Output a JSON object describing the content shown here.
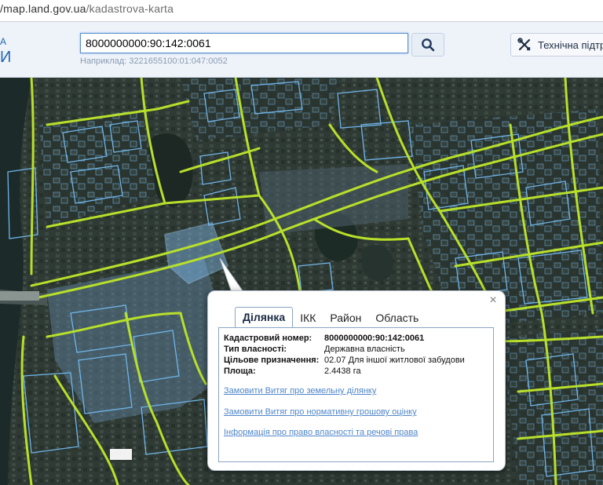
{
  "browser": {
    "url_host": "/map.land.gov.ua",
    "url_path": "/kadastrova-karta"
  },
  "header": {
    "logo_fragment_top": "А",
    "logo_fragment_bottom": "И",
    "search": {
      "value": "8000000000:90:142:0061",
      "example": "Наприклад: 3221655100:01:047:0052"
    },
    "support_label": "Технічна підтр"
  },
  "popup": {
    "tabs": [
      "Ділянка",
      "ІКК",
      "Район",
      "Область"
    ],
    "active_tab": "Ділянка",
    "fields": [
      {
        "key": "Кадастровий номер:",
        "value": "8000000000:90:142:0061"
      },
      {
        "key": "Тип власності:",
        "value": "Державна власність"
      },
      {
        "key": "Цільове призначення:",
        "value": "02.07 Для іншої житлової забудови"
      },
      {
        "key": "Площа:",
        "value": "2.4438 га"
      }
    ],
    "links": [
      "Замовити Витяг про земельну ділянку",
      "Замовити Витяг про нормативну грошову оцінку",
      "Інформація про право власності та речові права"
    ],
    "close_label": "×"
  },
  "colors": {
    "accent": "#2266b0",
    "parcel_outline": "#6fb5ea",
    "road_line": "#b8e02a",
    "link": "#4f86c9"
  },
  "icons": {
    "search": "search-icon",
    "support": "tools-icon",
    "close": "close-icon"
  }
}
